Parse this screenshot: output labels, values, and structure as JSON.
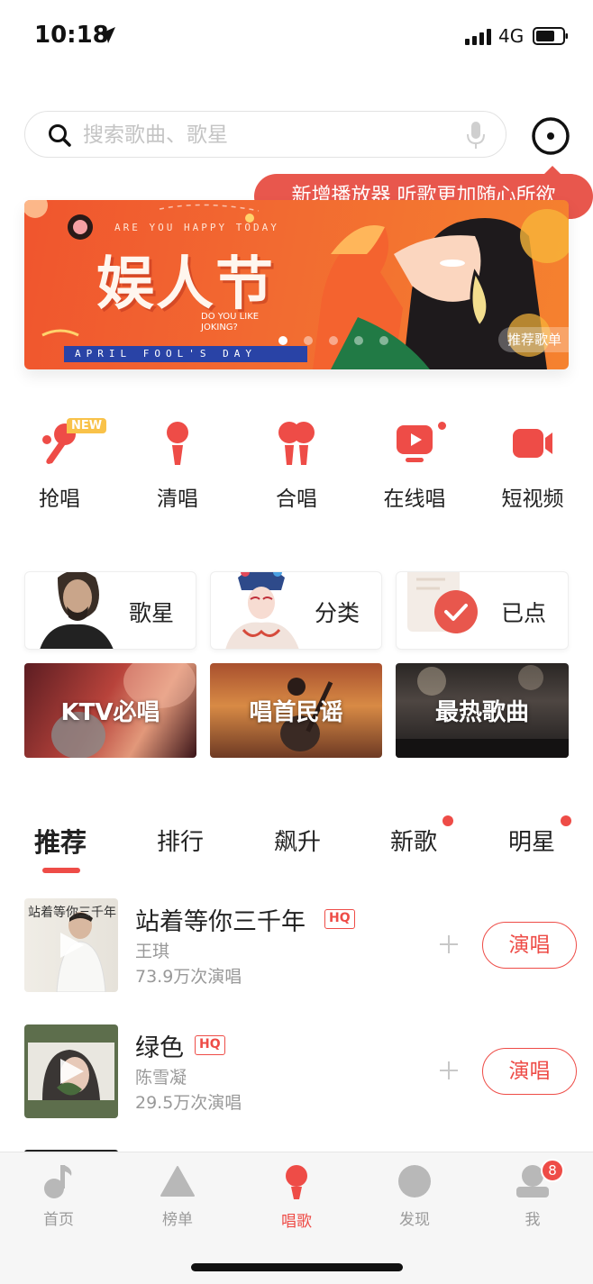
{
  "status_bar": {
    "time": "10:18",
    "network": "4G"
  },
  "search": {
    "placeholder": "搜索歌曲、歌星"
  },
  "tooltip": {
    "text": "新增播放器 听歌更加随心所欲"
  },
  "banner": {
    "subtitle": "ARE YOU HAPPY TODAY",
    "title": "娱人节",
    "small_text": "DO YOU LIKE JOKING?",
    "ribbon": "APRIL FOOL'S DAY",
    "tag": "推荐歌单",
    "page_count": 5,
    "active_page": 1
  },
  "features": [
    {
      "label": "抢唱",
      "icon": "mic-icon",
      "badge": "NEW"
    },
    {
      "label": "清唱",
      "icon": "mic-stand-icon"
    },
    {
      "label": "合唱",
      "icon": "duet-icon"
    },
    {
      "label": "在线唱",
      "icon": "live-tv-icon",
      "dot": true
    },
    {
      "label": "短视频",
      "icon": "video-camera-icon"
    }
  ],
  "categories": [
    {
      "label": "歌星"
    },
    {
      "label": "分类"
    },
    {
      "label": "已点"
    }
  ],
  "tiles": [
    {
      "label": "KTV必唱"
    },
    {
      "label": "唱首民谣"
    },
    {
      "label": "最热歌曲"
    }
  ],
  "tabs": [
    {
      "label": "推荐",
      "active": true
    },
    {
      "label": "排行"
    },
    {
      "label": "飙升"
    },
    {
      "label": "新歌",
      "dot": true
    },
    {
      "label": "明星",
      "dot": true
    }
  ],
  "songs": [
    {
      "title": "站着等你三千年",
      "quality": "HQ",
      "artist": "王琪",
      "plays": "73.9万次演唱",
      "action": "演唱",
      "cover_text": "站着等你三千年"
    },
    {
      "title": "绿色",
      "quality": "HQ",
      "artist": "陈雪凝",
      "plays": "29.5万次演唱",
      "action": "演唱"
    }
  ],
  "tabbar": [
    {
      "label": "首页",
      "icon": "music-note-icon"
    },
    {
      "label": "榜单",
      "icon": "triangle-icon"
    },
    {
      "label": "唱歌",
      "icon": "mic-icon",
      "active": true
    },
    {
      "label": "发现",
      "icon": "circle-icon"
    },
    {
      "label": "我",
      "icon": "profile-icon",
      "badge": "8"
    }
  ],
  "colors": {
    "accent": "#ee4c47",
    "badge_new": "#f9c249",
    "banner": "#f0552e"
  }
}
